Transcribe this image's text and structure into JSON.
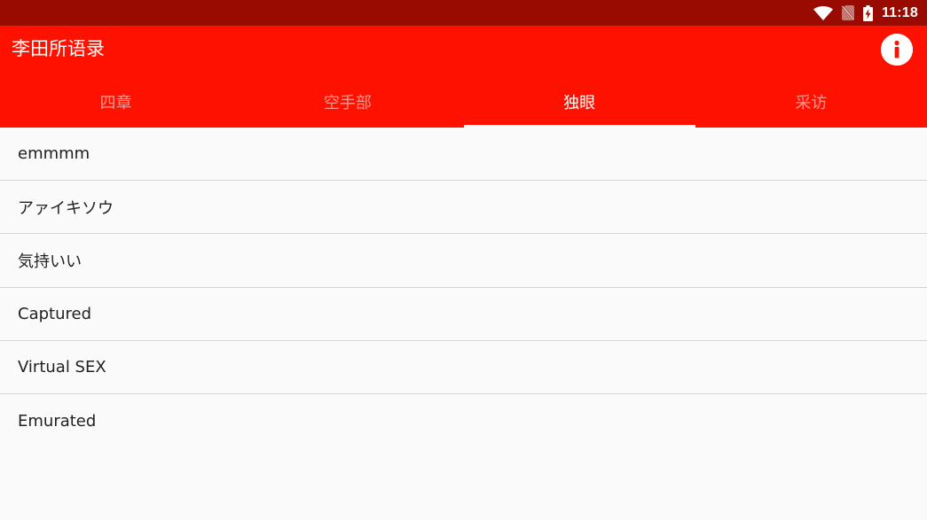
{
  "status_bar": {
    "time": "11:18",
    "icons": [
      "wifi-icon",
      "no-sim-icon",
      "battery-charging-icon"
    ]
  },
  "app_bar": {
    "title": "李田所语录",
    "action_icon": "info-icon"
  },
  "tabs": [
    {
      "label": "四章",
      "active": false
    },
    {
      "label": "空手部",
      "active": false
    },
    {
      "label": "独眼",
      "active": true
    },
    {
      "label": "采访",
      "active": false
    }
  ],
  "list": {
    "items": [
      {
        "label": "emmmm"
      },
      {
        "label": "アァイキソウ"
      },
      {
        "label": "気持いい"
      },
      {
        "label": "Captured"
      },
      {
        "label": "Virtual SEX"
      },
      {
        "label": "Emurated"
      }
    ]
  },
  "colors": {
    "status_bar": "#990a00",
    "app_bar": "#ff1100",
    "background": "#fafafa",
    "divider": "#d6d6d6",
    "text": "#212121"
  }
}
